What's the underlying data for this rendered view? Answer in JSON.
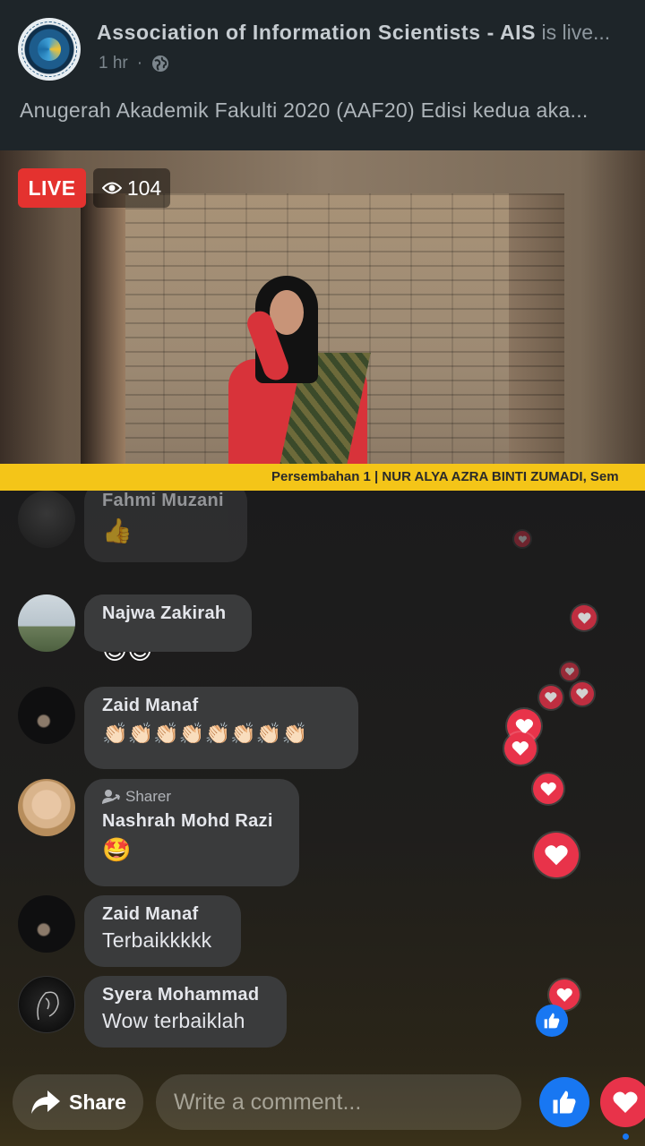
{
  "header": {
    "page_name": "Association of Information Scientists - AIS",
    "live_suffix": "is live...",
    "time": "1 hr",
    "privacy_icon": "globe-icon",
    "post_text": "Anugerah Akademik Fakulti 2020 (AAF20) Edisi kedua aka..."
  },
  "video": {
    "live_label": "LIVE",
    "viewer_count": "104",
    "viewer_icon": "eye-icon",
    "ticker": "Persembahan 1 | NUR ALYA AZRA BINTI ZUMADI, Sem"
  },
  "comments": [
    {
      "name": "Fahmi Muzani",
      "emoji": "👍"
    },
    {
      "name": "Najwa Zakirah",
      "emoji": "😍😍"
    },
    {
      "name": "Zaid Manaf",
      "emoji": "👏🏻👏🏻👏🏻👏🏻👏🏻👏🏻👏🏻👏🏻"
    },
    {
      "badge": "Sharer",
      "name": "Nashrah Mohd Razi",
      "emoji": "🤩"
    },
    {
      "name": "Zaid Manaf",
      "text": "Terbaikkkkk"
    },
    {
      "name": "Syera Mohammad",
      "text": "Wow terbaiklah"
    }
  ],
  "bottom_bar": {
    "share_label": "Share",
    "comment_placeholder": "Write a comment..."
  },
  "colors": {
    "live_red": "#e4322f",
    "like_blue": "#1877f2",
    "love_red": "#e8334a",
    "ticker_yellow": "#f4c518"
  }
}
